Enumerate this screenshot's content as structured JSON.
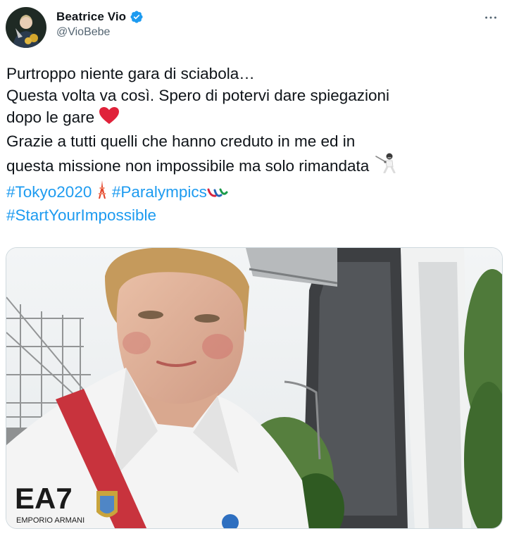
{
  "author": {
    "display_name": "Beatrice Vio",
    "handle": "@VioBebe",
    "verified_icon": "verified-badge-icon",
    "verified_color": "#1d9bf0"
  },
  "more_icon": "more-horizontal-icon",
  "tweet": {
    "line1": "Purtroppo niente gara di sciabola…",
    "line2": "Questa volta va così. Spero di potervi dare spiegazioni",
    "line3": "dopo le gare",
    "line4": "Grazie a tutti quelli che hanno creduto in me ed in",
    "line5": "questa missione non impossibile ma solo rimandata",
    "hashtag1": "#Tokyo2020",
    "hashtag2": "#Paralympics",
    "hashtag3": "#StartYourImpossible",
    "emojis": [
      "red-heart-emoji",
      "fencer-emoji",
      "tokyo-tower-emoji",
      "paralympics-emoji"
    ],
    "hashtag_color": "#1d9bf0"
  },
  "media": {
    "type": "photo",
    "jacket_logo": "EA7",
    "jacket_sublogo": "EMPORIO ARMANI"
  }
}
